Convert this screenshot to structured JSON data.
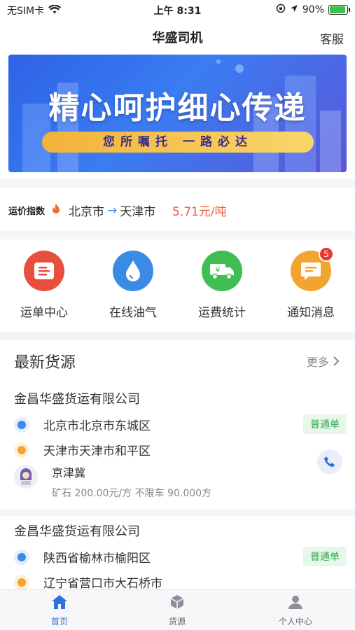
{
  "status_bar": {
    "carrier": "无SIM卡",
    "time": "上午 8:31",
    "battery": "90%",
    "battery_level": 0.9
  },
  "nav": {
    "title": "华盛司机",
    "service_label": "客服"
  },
  "banner": {
    "headline": "精心呵护细心传递",
    "tagline": "您所嘱托 一路必达"
  },
  "price_index": {
    "label": "运价指数",
    "fire_icon": "fire-icon",
    "from": "北京市",
    "arrow": "→",
    "to": "天津市",
    "price": "5.71元/吨"
  },
  "quick_actions": [
    {
      "label": "运单中心",
      "icon": "waybill-icon",
      "color": "#e94f3f"
    },
    {
      "label": "在线油气",
      "icon": "oil-drop-icon",
      "color": "#3b8be6"
    },
    {
      "label": "运费统计",
      "icon": "freight-truck-icon",
      "color": "#3fbe53"
    },
    {
      "label": "通知消息",
      "icon": "message-icon",
      "color": "#f2a52e",
      "badge": "5"
    }
  ],
  "section": {
    "title": "最新货源",
    "more_label": "更多"
  },
  "cargo_list": [
    {
      "company": "金昌华盛货运有限公司",
      "origin": "北京市北京市东城区",
      "destination": "天津市天津市和平区",
      "tag": "普通单",
      "shipper": "京津冀",
      "detail": "矿石 200.00元/方 不限车 90.000方"
    },
    {
      "company": "金昌华盛货运有限公司",
      "origin": "陕西省榆林市榆阳区",
      "destination": "辽宁省营口市大石桥市",
      "tag": "普通单"
    }
  ],
  "tabbar": [
    {
      "label": "首页",
      "icon": "home-icon",
      "active": true
    },
    {
      "label": "货源",
      "icon": "cargo-box-icon",
      "active": false
    },
    {
      "label": "个人中心",
      "icon": "user-icon",
      "active": false
    }
  ],
  "colors": {
    "accent": "#2f6fe0",
    "price": "#ef5a3b",
    "tag_green": "#2fa84f"
  }
}
